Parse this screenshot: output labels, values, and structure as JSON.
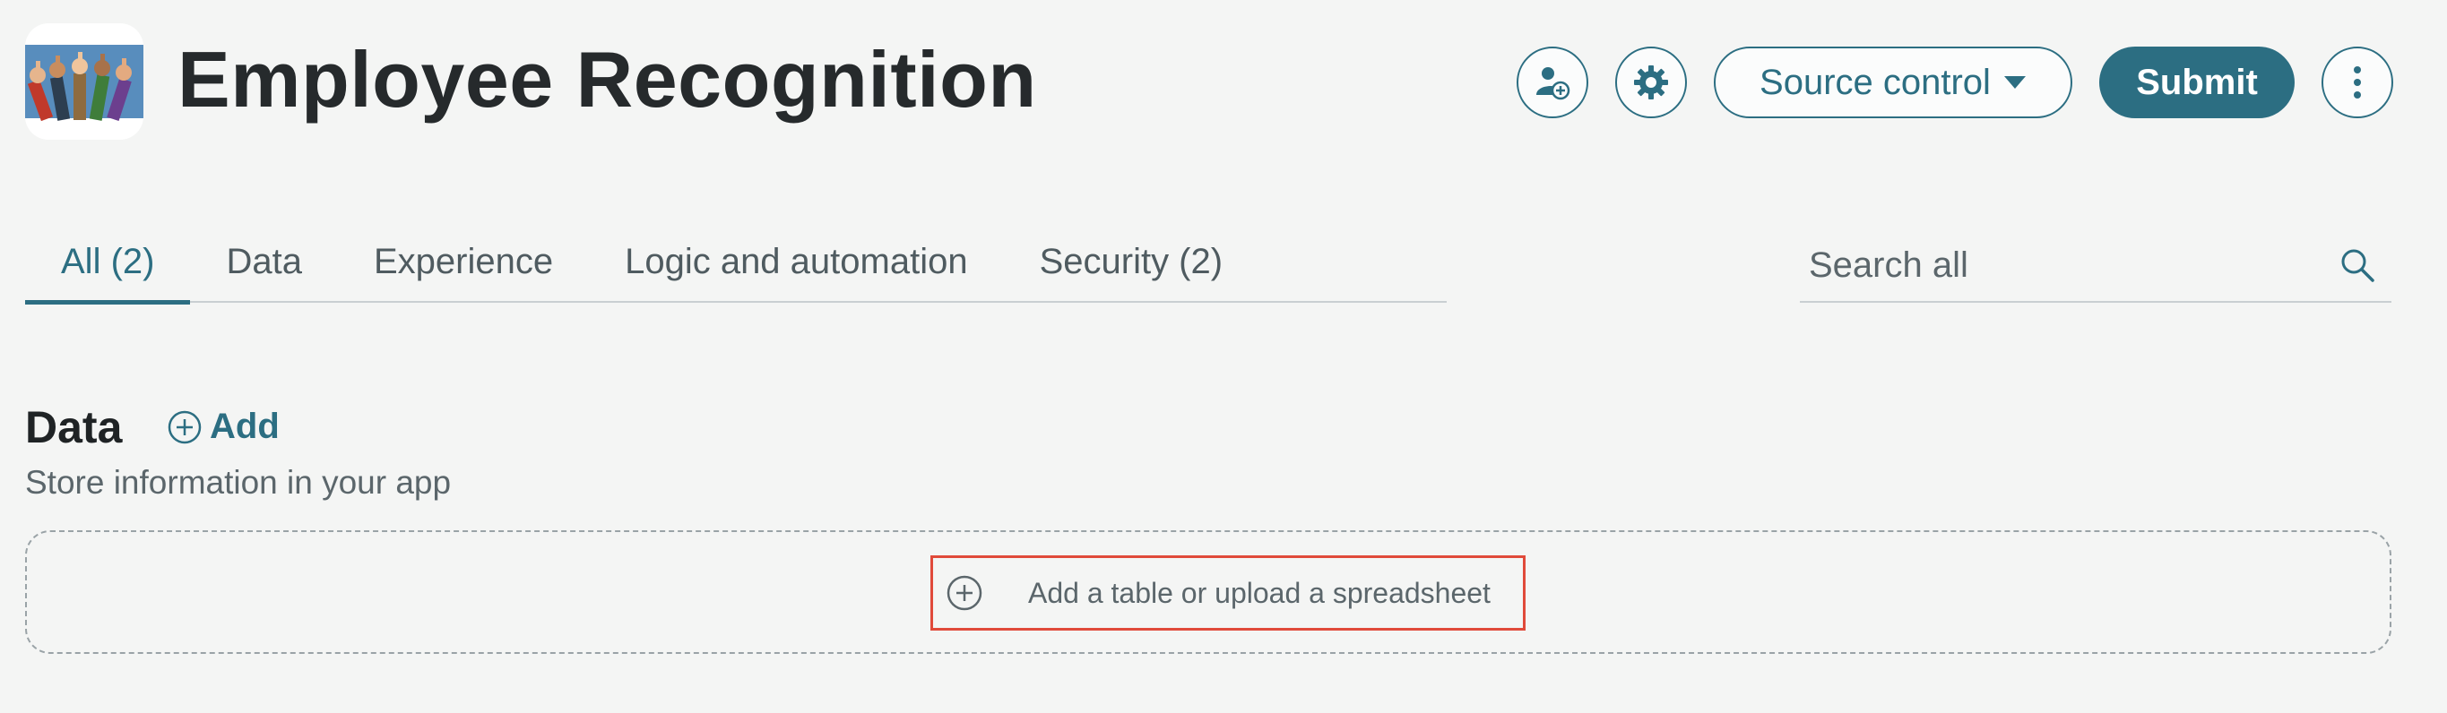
{
  "header": {
    "app_title": "Employee Recognition",
    "logo_icon": "thumbs-up-hands-logo",
    "share_icon": "user-add-icon",
    "settings_icon": "gear-icon",
    "source_control_label": "Source control",
    "submit_label": "Submit",
    "more_icon": "vertical-dots-icon"
  },
  "tabs": [
    {
      "label": "All (2)",
      "active": true
    },
    {
      "label": "Data",
      "active": false
    },
    {
      "label": "Experience",
      "active": false
    },
    {
      "label": "Logic and automation",
      "active": false
    },
    {
      "label": "Security (2)",
      "active": false
    }
  ],
  "search": {
    "placeholder": "Search all"
  },
  "data_section": {
    "title": "Data",
    "add_label": "Add",
    "description": "Store information in your app",
    "empty_action_label": "Add a table or upload a spreadsheet"
  },
  "colors": {
    "accent": "#2c6e82",
    "highlight": "#e04a3a",
    "background": "#f4f5f4"
  }
}
